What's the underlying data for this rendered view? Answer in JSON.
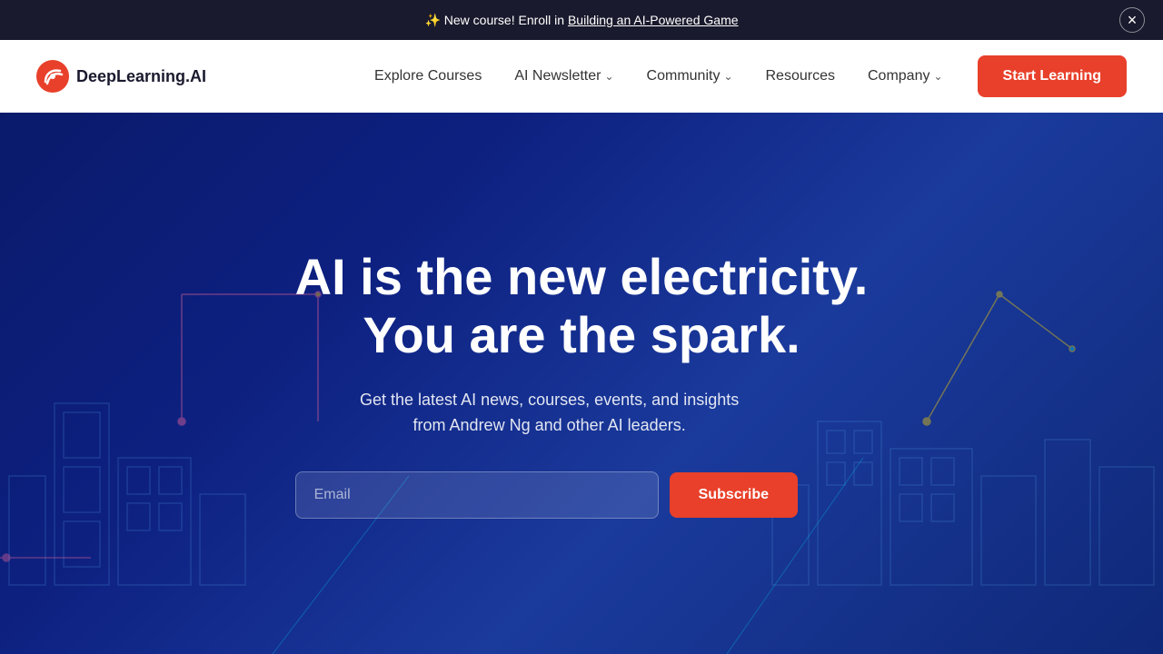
{
  "announcement": {
    "prefix": "✨ New course! Enroll in ",
    "link_text": "Building an AI-Powered Game",
    "link_url": "#"
  },
  "navbar": {
    "logo_text": "DeepLearning.AI",
    "links": [
      {
        "label": "Explore Courses",
        "has_dropdown": false
      },
      {
        "label": "AI Newsletter",
        "has_dropdown": true
      },
      {
        "label": "Community",
        "has_dropdown": true
      },
      {
        "label": "Resources",
        "has_dropdown": false
      },
      {
        "label": "Company",
        "has_dropdown": true
      }
    ],
    "cta_label": "Start Learning"
  },
  "hero": {
    "title_line1": "AI is the new electricity.",
    "title_line2": "You are the spark.",
    "subtitle_line1": "Get the latest AI news, courses, events, and insights",
    "subtitle_line2": "from Andrew Ng and other AI leaders.",
    "email_placeholder": "Email",
    "subscribe_label": "Subscribe"
  },
  "icons": {
    "close": "×",
    "chevron_down": "⌄"
  }
}
